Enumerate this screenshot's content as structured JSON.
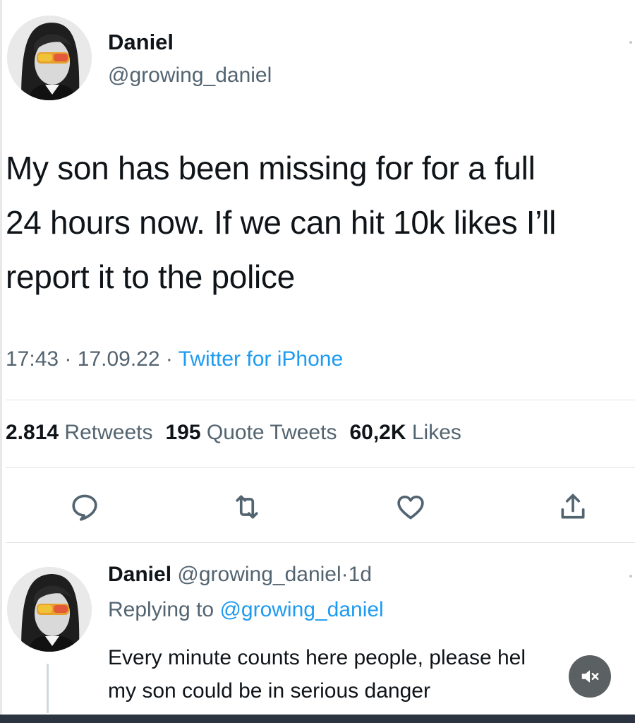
{
  "tweet": {
    "author": {
      "display_name": "Daniel",
      "handle": "@growing_daniel"
    },
    "text_lines": [
      "My son has been missing for for a full",
      "24 hours now. If we can hit 10k likes I’ll",
      "report it to the police"
    ],
    "time": "17:43",
    "separator": "·",
    "date": "17.09.22",
    "source": "Twitter for iPhone",
    "stats": {
      "retweets_count": "2.814",
      "retweets_label": "Retweets",
      "quotes_count": "195",
      "quotes_label": "Quote Tweets",
      "likes_count": "60,2K",
      "likes_label": "Likes"
    },
    "actions": [
      "reply-icon",
      "retweet-icon",
      "like-icon",
      "share-icon"
    ]
  },
  "reply": {
    "author": {
      "display_name": "Daniel",
      "handle": "@growing_daniel"
    },
    "separator": "·",
    "age": "1d",
    "replying_prefix": "Replying to",
    "replying_mention": "@growing_daniel",
    "text_lines": [
      "Every minute counts here people, please hel",
      "my son could be in serious danger"
    ]
  },
  "colors": {
    "text": "#0f1419",
    "secondary": "#536471",
    "link": "#1d9bf0",
    "mute_button": "#5b6063",
    "bottom_bar": "#2b3440"
  },
  "overlay": {
    "mute_icon": "speaker-muted-icon"
  }
}
